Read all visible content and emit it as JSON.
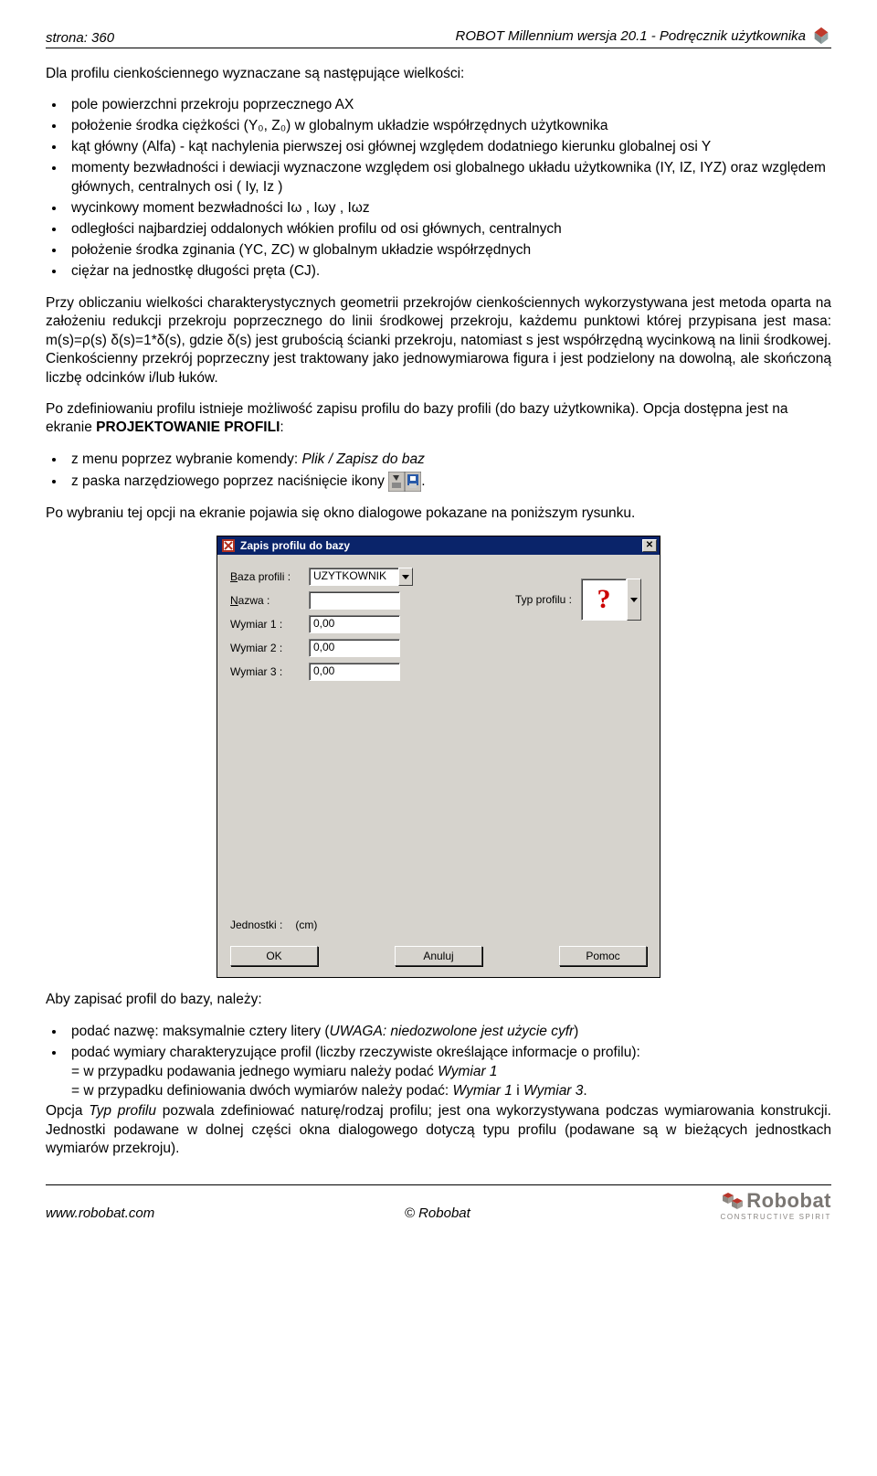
{
  "header": {
    "left": "strona: 360",
    "right": "ROBOT Millennium wersja 20.1 - Podręcznik użytkownika"
  },
  "intro": "Dla profilu cienkościennego wyznaczane są następujące wielkości:",
  "bullets1": [
    "pole powierzchni przekroju poprzecznego AX",
    "położenie środka ciężkości (Y₀, Z₀) w globalnym układzie współrzędnych użytkownika",
    "kąt główny (Alfa) - kąt nachylenia pierwszej osi głównej względem dodatniego kierunku globalnej osi Y",
    "momenty bezwładności i dewiacji wyznaczone względem osi globalnego układu użytkownika (IY, IZ, IYZ) oraz względem głównych, centralnych osi ( Iy, Iz )",
    "wycinkowy moment bezwładności Iω , Iωy , Iωz",
    "odległości najbardziej oddalonych włókien profilu od osi głównych, centralnych",
    "położenie środka zginania (YC, ZC) w globalnym układzie współrzędnych",
    "ciężar na jednostkę długości pręta (CJ)."
  ],
  "para2": "Przy obliczaniu wielkości charakterystycznych geometrii przekrojów cienkościennych wykorzystywana jest metoda oparta na założeniu redukcji przekroju poprzecznego do linii środkowej przekroju, każdemu punktowi której przypisana jest masa: m(s)=ρ(s) δ(s)=1*δ(s), gdzie δ(s) jest grubością ścianki przekroju, natomiast s jest współrzędną wycinkową na linii środkowej. Cienkościenny przekrój poprzeczny jest traktowany jako jednowymiarowa figura i jest podzielony na dowolną, ale skończoną liczbę odcinków i/lub łuków.",
  "para3a": "Po zdefiniowaniu profilu istnieje możliwość zapisu profilu do bazy profili (do bazy użytkownika). Opcja dostępna jest na ekranie ",
  "para3b": "PROJEKTOWANIE PROFILI",
  "para3c": ":",
  "bullets2_item1a": "z menu poprzez wybranie komendy: ",
  "bullets2_item1b": "Plik / Zapisz do baz",
  "bullets2_item2a": "z paska narzędziowego poprzez naciśnięcie ikony ",
  "bullets2_item2b": ".",
  "para4": "Po wybraniu tej opcji na ekranie pojawia się okno dialogowe pokazane na poniższym rysunku.",
  "dialog": {
    "title": "Zapis profilu do bazy",
    "baza_label": "Baza profili :",
    "baza_value": "UZYTKOWNIK",
    "typ_label": "Typ profilu :",
    "nazwa_label": "Nazwa :",
    "nazwa_value": "",
    "w1_label": "Wymiar 1 :",
    "w1_value": "0,00",
    "w2_label": "Wymiar 2 :",
    "w2_value": "0,00",
    "w3_label": "Wymiar 3 :",
    "w3_value": "0,00",
    "units_label": "Jednostki :",
    "units_value": "(cm)",
    "ok": "OK",
    "cancel": "Anuluj",
    "help": "Pomoc",
    "qmark": "?"
  },
  "para5": "Aby zapisać profil do bazy, należy:",
  "b3_item1a": "podać nazwę: maksymalnie cztery litery (",
  "b3_item1b": "UWAGA: niedozwolone jest użycie cyfr",
  "b3_item1c": ")",
  "b3_item2": "podać wymiary charakteryzujące profil (liczby rzeczywiste określające informacje o profilu):",
  "b3_sub1a": "= w przypadku podawania jednego wymiaru należy podać ",
  "b3_sub1b": "Wymiar 1",
  "b3_sub2a": "= w przypadku definiowania dwóch wymiarów należy podać: ",
  "b3_sub2b": "Wymiar 1",
  "b3_sub2c": " i ",
  "b3_sub2d": "Wymiar 3",
  "b3_sub2e": ".",
  "para6a": "Opcja ",
  "para6b": "Typ profilu",
  "para6c": " pozwala zdefiniować naturę/rodzaj profilu; jest ona wykorzystywana podczas wymiarowania konstrukcji. Jednostki podawane w dolnej części okna dialogowego dotyczą typu profilu (podawane są w bieżących jednostkach wymiarów przekroju).",
  "footer": {
    "left": "www.robobat.com",
    "center": "© Robobat",
    "brand": "Robobat",
    "tag": "CONSTRUCTIVE SPIRIT"
  }
}
